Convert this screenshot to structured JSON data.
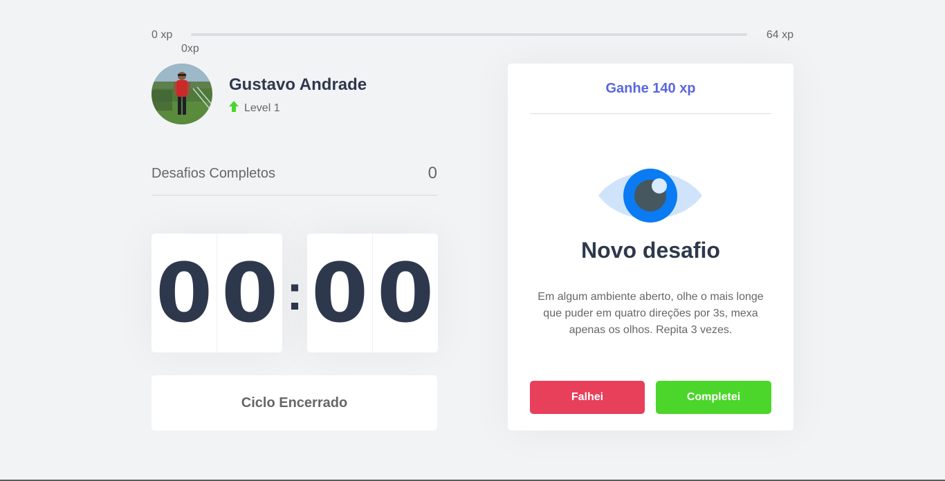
{
  "xp": {
    "min_label": "0 xp",
    "max_label": "64 xp",
    "current_label": "0xp",
    "progress_fraction": 0
  },
  "profile": {
    "name": "Gustavo Andrade",
    "level": "Level 1"
  },
  "completed": {
    "label": "Desafios Completos",
    "count": "0"
  },
  "countdown": {
    "minute_left": "0",
    "minute_right": "0",
    "separator": ":",
    "second_left": "0",
    "second_right": "0"
  },
  "cycle": {
    "button_label": "Ciclo Encerrado"
  },
  "challenge": {
    "header": "Ganhe 140 xp",
    "icon": "eye-icon",
    "title": "Novo desafio",
    "description": "Em algum ambiente aberto, olhe o mais longe que puder em quatro direções por 3s, mexa apenas os olhos. Repita 3 vezes.",
    "fail_label": "Falhei",
    "success_label": "Completei"
  },
  "colors": {
    "accent": "#5965e0",
    "success": "#4cd62b",
    "danger": "#e83f5b",
    "title": "#2e384d",
    "text": "#666666",
    "background": "#f2f3f5"
  }
}
